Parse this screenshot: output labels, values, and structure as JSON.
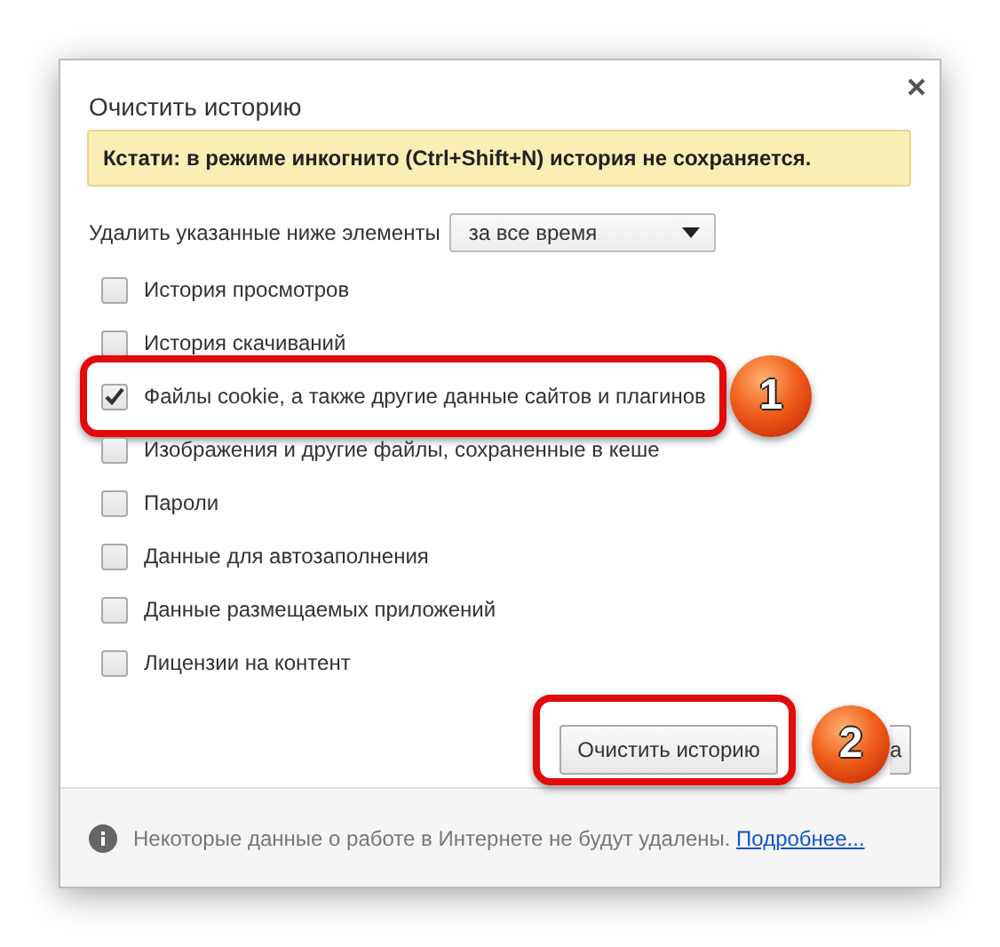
{
  "dialog": {
    "title": "Очистить историю",
    "notice": "Кстати: в режиме инкогнито (Ctrl+Shift+N) история не сохраняется.",
    "range": {
      "label": "Удалить указанные ниже элементы",
      "value": "за все время"
    },
    "items": [
      {
        "label": "История просмотров",
        "checked": false
      },
      {
        "label": "История скачиваний",
        "checked": false
      },
      {
        "label": "Файлы cookie, а также другие данные сайтов и плагинов",
        "checked": true,
        "annotation": "1"
      },
      {
        "label": "Изображения и другие файлы, сохраненные в кеше",
        "checked": false
      },
      {
        "label": "Пароли",
        "checked": false
      },
      {
        "label": "Данные для автозаполнения",
        "checked": false
      },
      {
        "label": "Данные размещаемых приложений",
        "checked": false
      },
      {
        "label": "Лицензии на контент",
        "checked": false
      }
    ],
    "buttons": [
      {
        "label": "Очистить историю",
        "kind": "primary",
        "annotation": "2"
      },
      {
        "label": "а",
        "kind": "cancel"
      }
    ],
    "footer": {
      "text": "Некоторые данные о работе в Интернете не будут удалены.",
      "link": "Подробнее..."
    }
  }
}
